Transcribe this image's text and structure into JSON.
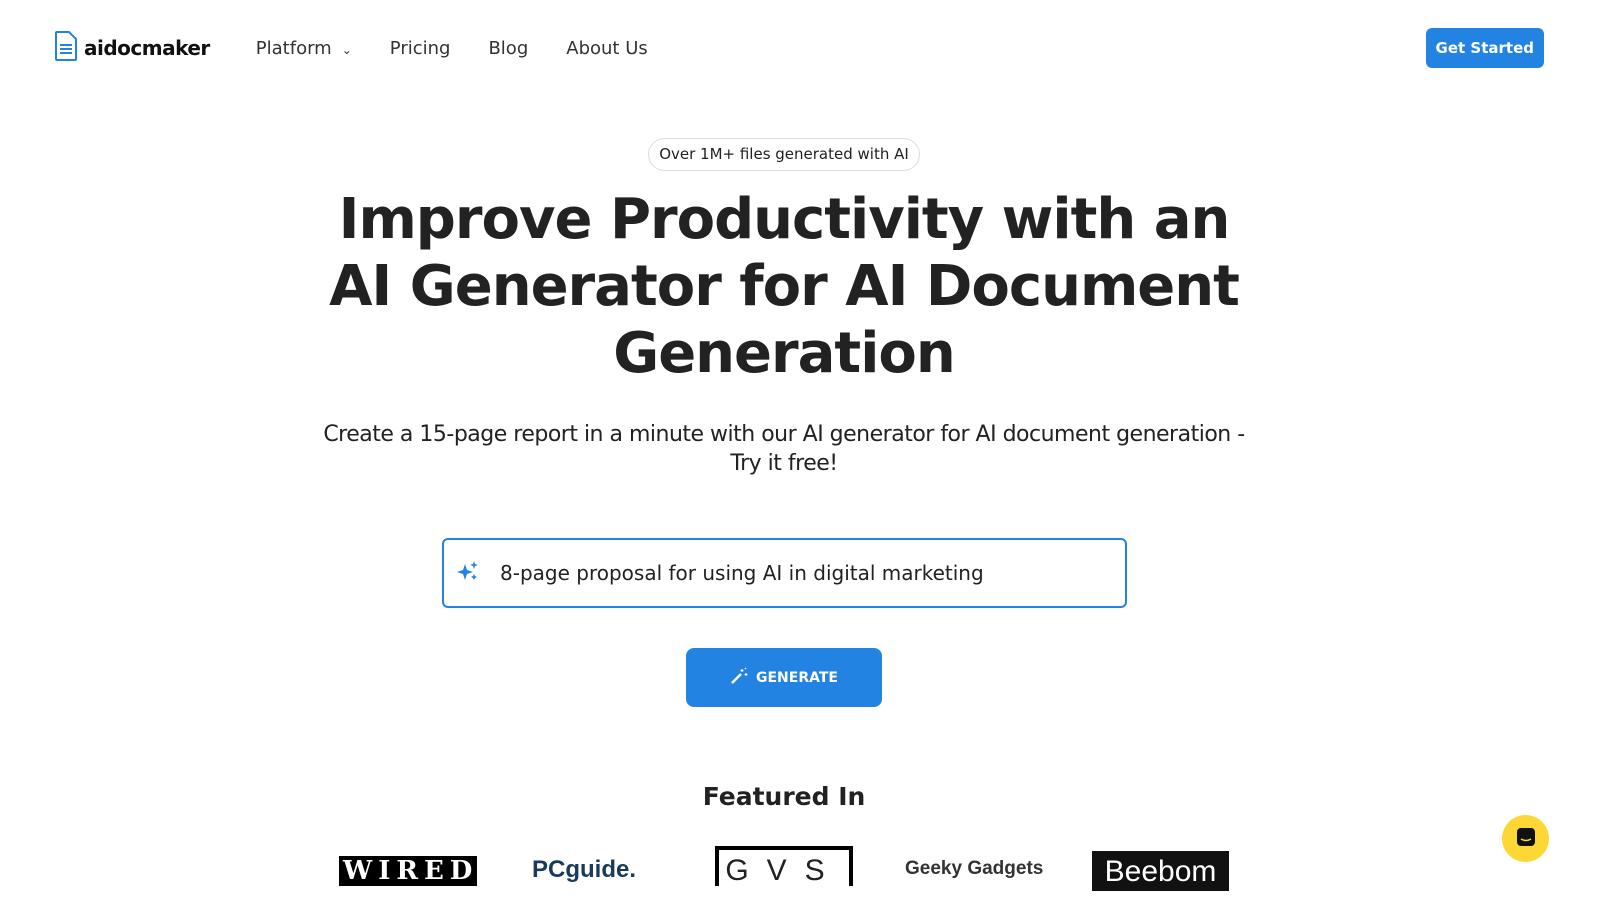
{
  "nav": {
    "brand": "aidocmaker",
    "items": [
      "Platform",
      "Pricing",
      "Blog",
      "About Us"
    ],
    "cta": "Get Started"
  },
  "hero": {
    "badge": "Over 1M+ files generated with AI",
    "title": "Improve Productivity with an AI Generator for AI Document Generation",
    "subtitle": "Create a 15-page report in a minute with our AI generator for AI document generation - Try it free!"
  },
  "prompt": {
    "value": "8-page proposal for using AI in digital marketing"
  },
  "generate": {
    "label": "GENERATE"
  },
  "featured": {
    "title": "Featured In",
    "logos": [
      "WIRED",
      "PCguide.",
      "GVS",
      "Geeky Gadgets",
      "Beebom"
    ]
  },
  "colors": {
    "accent": "#2383e2",
    "chat": "#fdd835"
  }
}
